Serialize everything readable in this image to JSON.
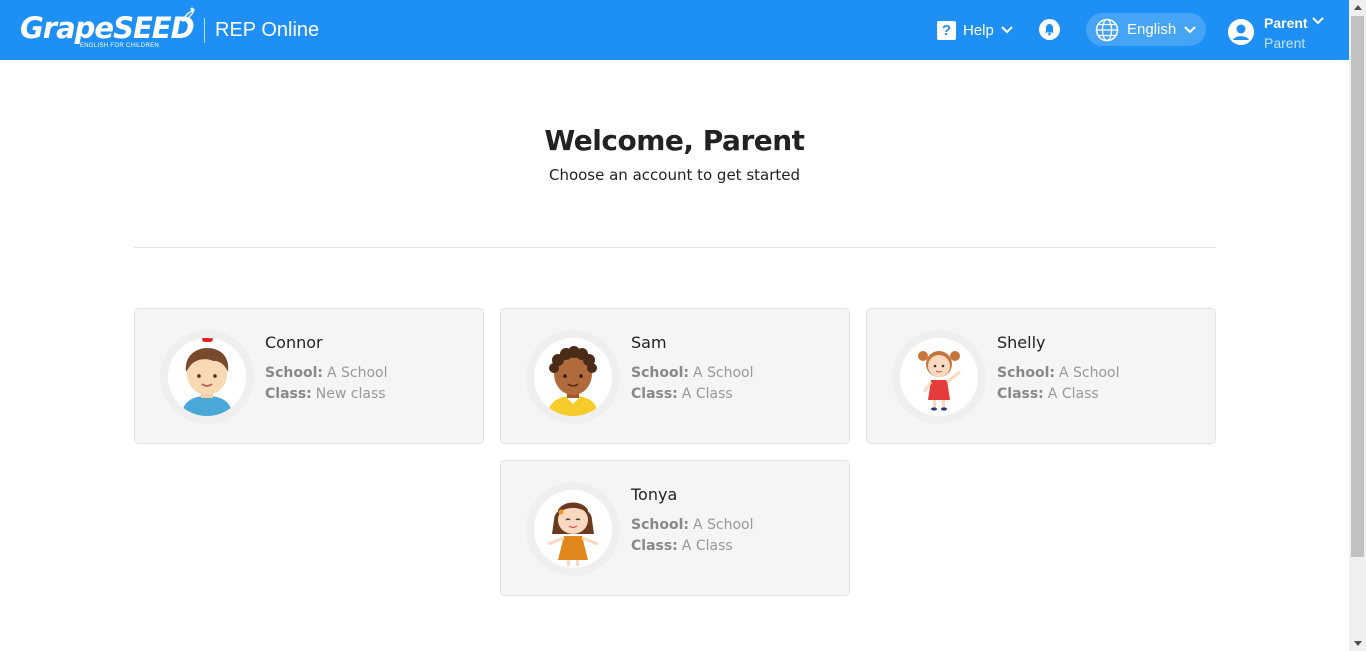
{
  "header": {
    "logo_text": "GrapeSEED",
    "logo_tagline": "ENGLISH FOR CHILDREN",
    "app_title": "REP Online",
    "help_label": "Help",
    "language": "English",
    "user_name": "Parent",
    "user_role": "Parent",
    "accent": "#1e90f5"
  },
  "welcome": {
    "title": "Welcome, Parent",
    "subtitle": "Choose an account to get started"
  },
  "labels": {
    "school": "School:",
    "class": "Class:"
  },
  "accounts": [
    {
      "name": "Connor",
      "school": "A School",
      "class": "New class",
      "avatar": "boy-red-hair-clip"
    },
    {
      "name": "Sam",
      "school": "A School",
      "class": "A Class",
      "avatar": "boy-curly-hair"
    },
    {
      "name": "Shelly",
      "school": "A School",
      "class": "A Class",
      "avatar": "girl-pigtails-red-dress"
    },
    {
      "name": "Tonya",
      "school": "A School",
      "class": "A Class",
      "avatar": "girl-brown-hair-orange-dress"
    }
  ]
}
